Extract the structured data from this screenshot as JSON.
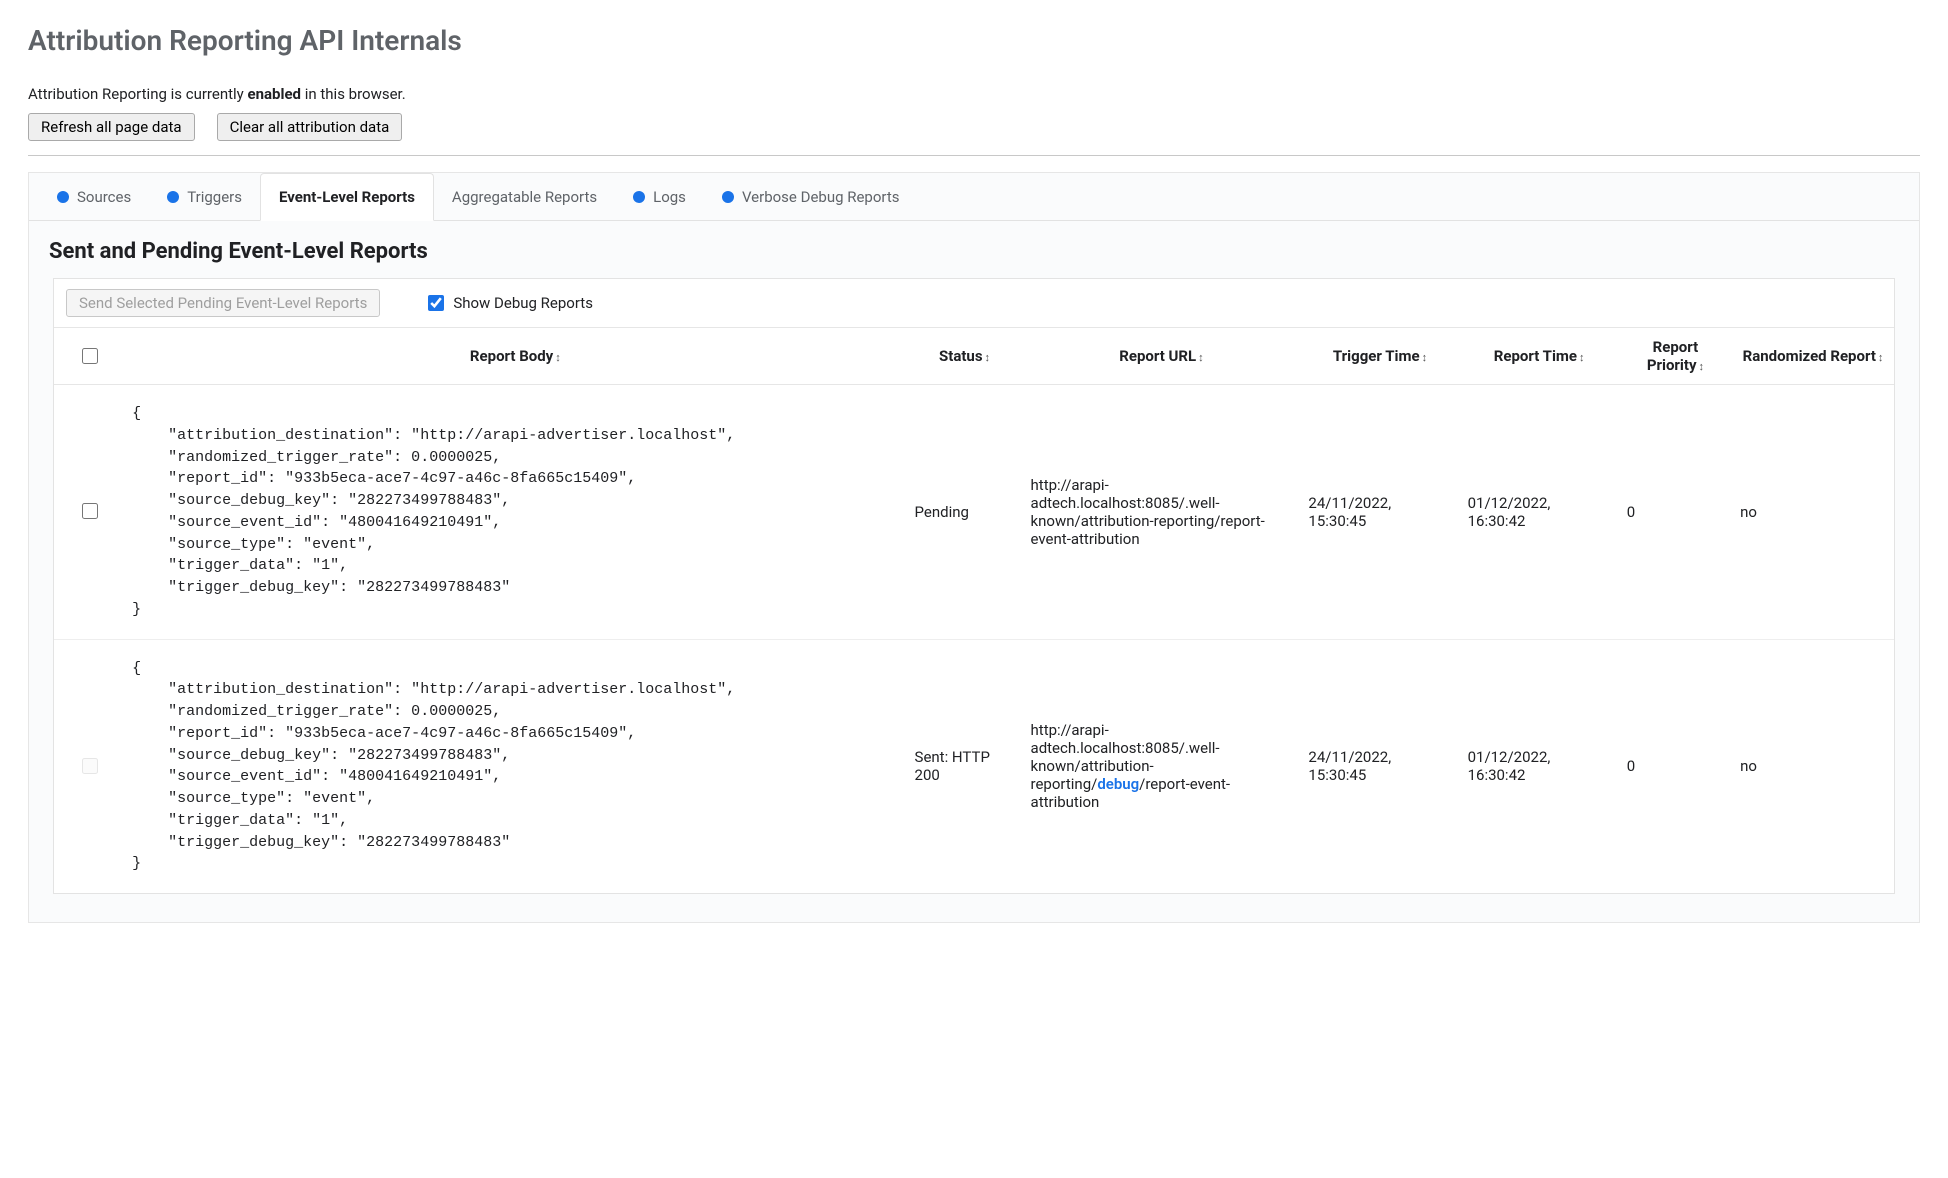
{
  "page_title": "Attribution Reporting API Internals",
  "status_prefix": "Attribution Reporting is currently ",
  "status_value": "enabled",
  "status_suffix": " in this browser.",
  "buttons": {
    "refresh": "Refresh all page data",
    "clear": "Clear all attribution data"
  },
  "tabs": [
    {
      "label": "Sources",
      "dot": true,
      "active": false
    },
    {
      "label": "Triggers",
      "dot": true,
      "active": false
    },
    {
      "label": "Event-Level Reports",
      "dot": false,
      "active": true
    },
    {
      "label": "Aggregatable Reports",
      "dot": false,
      "active": false
    },
    {
      "label": "Logs",
      "dot": true,
      "active": false
    },
    {
      "label": "Verbose Debug Reports",
      "dot": true,
      "active": false
    }
  ],
  "section_title": "Sent and Pending Event-Level Reports",
  "controls": {
    "send_selected": "Send Selected Pending Event-Level Reports",
    "show_debug": "Show Debug Reports",
    "show_debug_checked": true
  },
  "columns": {
    "body": "Report Body",
    "status": "Status",
    "url": "Report URL",
    "trigger_time": "Trigger Time",
    "report_time": "Report Time",
    "priority": "Report Priority",
    "randomized": "Randomized Report"
  },
  "rows": [
    {
      "checkbox_enabled": true,
      "body": "{\n    \"attribution_destination\": \"http://arapi-advertiser.localhost\",\n    \"randomized_trigger_rate\": 0.0000025,\n    \"report_id\": \"933b5eca-ace7-4c97-a46c-8fa665c15409\",\n    \"source_debug_key\": \"282273499788483\",\n    \"source_event_id\": \"480041649210491\",\n    \"source_type\": \"event\",\n    \"trigger_data\": \"1\",\n    \"trigger_debug_key\": \"282273499788483\"\n}",
      "status": "Pending",
      "url_pre": "http://arapi-adtech.localhost:8085/.well-known/attribution-reporting/report-event-attribution",
      "url_em": "",
      "url_post": "",
      "trigger_time": "24/11/2022, 15:30:45",
      "report_time": "01/12/2022, 16:30:42",
      "priority": "0",
      "randomized": "no"
    },
    {
      "checkbox_enabled": false,
      "body": "{\n    \"attribution_destination\": \"http://arapi-advertiser.localhost\",\n    \"randomized_trigger_rate\": 0.0000025,\n    \"report_id\": \"933b5eca-ace7-4c97-a46c-8fa665c15409\",\n    \"source_debug_key\": \"282273499788483\",\n    \"source_event_id\": \"480041649210491\",\n    \"source_type\": \"event\",\n    \"trigger_data\": \"1\",\n    \"trigger_debug_key\": \"282273499788483\"\n}",
      "status": "Sent: HTTP 200",
      "url_pre": "http://arapi-adtech.localhost:8085/.well-known/attribution-reporting/",
      "url_em": "debug",
      "url_post": "/report-event-attribution",
      "trigger_time": "24/11/2022, 15:30:45",
      "report_time": "01/12/2022, 16:30:42",
      "priority": "0",
      "randomized": "no"
    }
  ]
}
